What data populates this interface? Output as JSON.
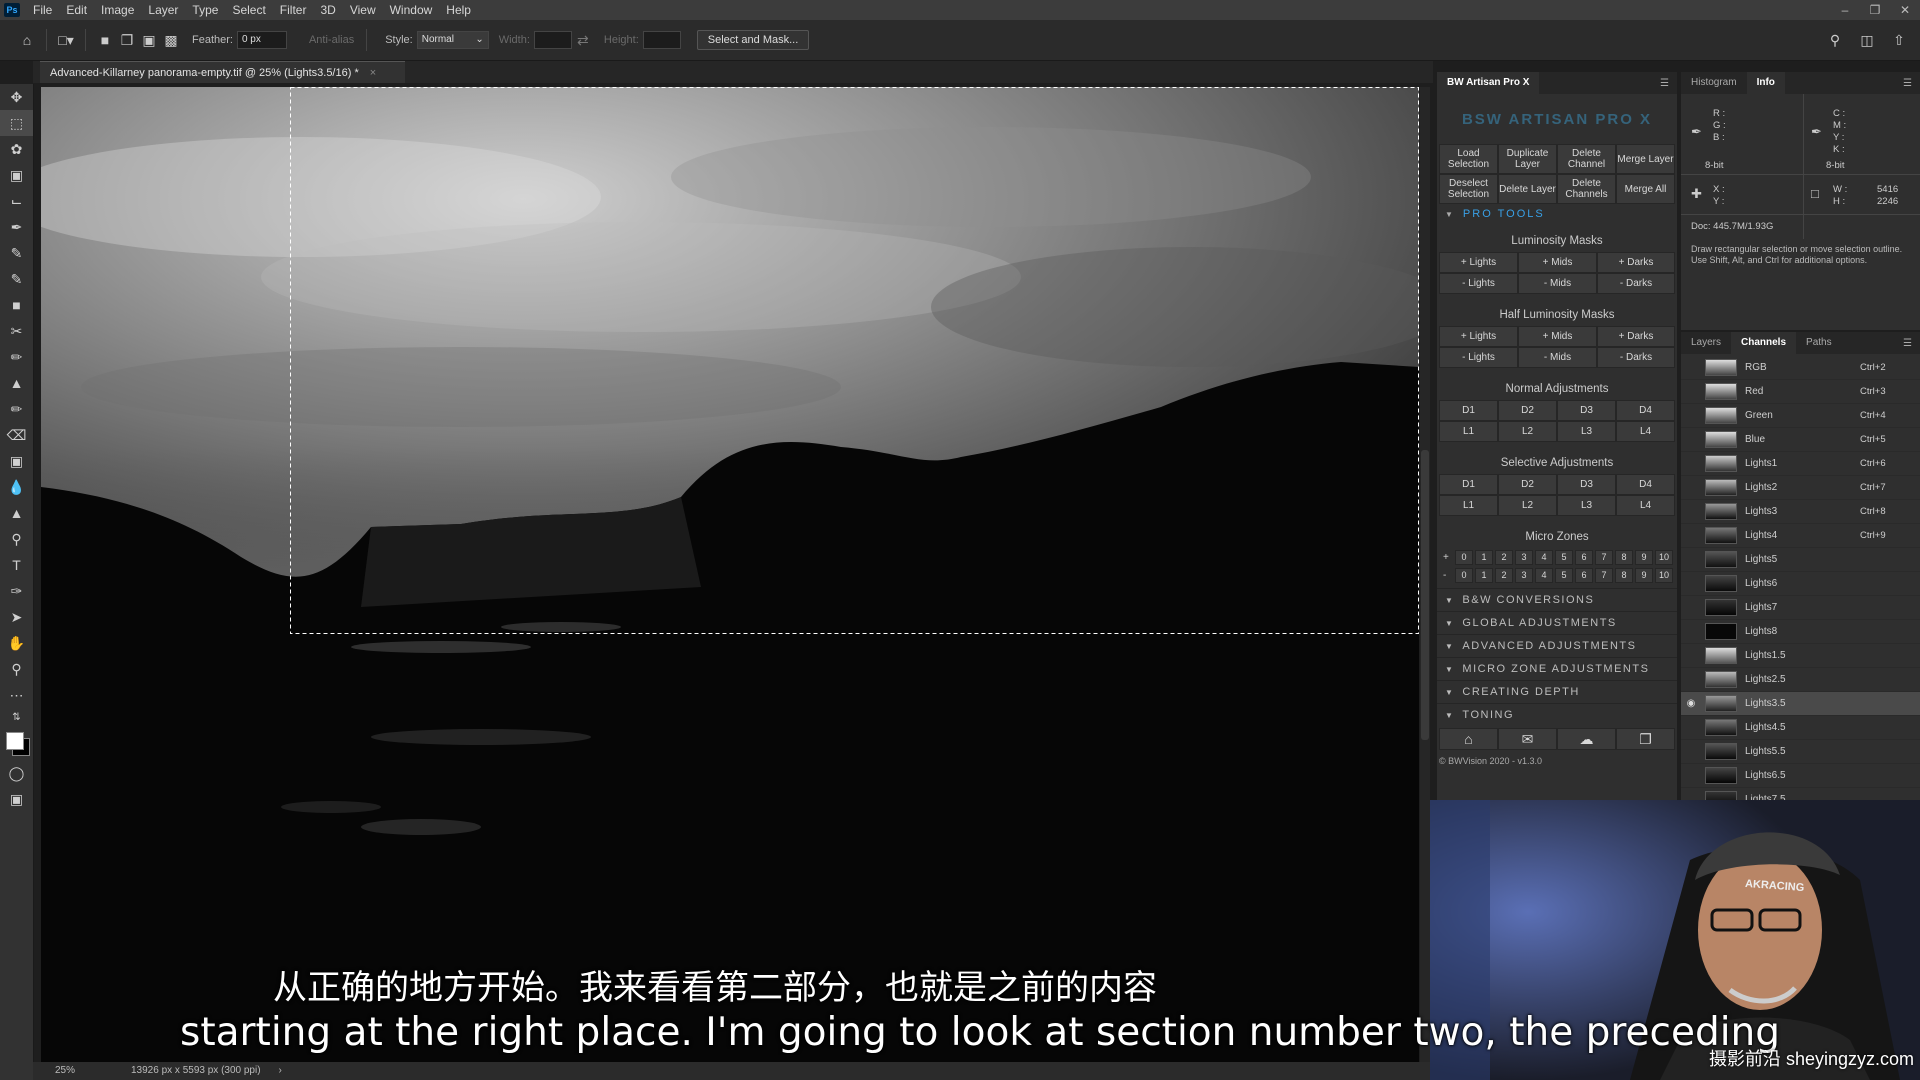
{
  "menubar": {
    "logo": "Ps",
    "items": [
      "File",
      "Edit",
      "Image",
      "Layer",
      "Type",
      "Select",
      "Filter",
      "3D",
      "View",
      "Window",
      "Help"
    ]
  },
  "options": {
    "feather_label": "Feather:",
    "feather_value": "0 px",
    "antialias_label": "Anti-alias",
    "style_label": "Style:",
    "style_value": "Normal",
    "width_label": "Width:",
    "height_label": "Height:",
    "select_mask_button": "Select and Mask..."
  },
  "document": {
    "tab_title": "Advanced-Killarney panorama-empty.tif @ 25% (Lights3.5/16) *",
    "zoom": "25%",
    "dimensions": "13926 px x 5593 px (300 ppi)"
  },
  "bw_panel": {
    "title": "BW Artisan Pro X",
    "logo_text": "BSW ARTISAN PRO X",
    "row1": [
      "Load Selection",
      "Duplicate Layer",
      "Delete Channel",
      "Merge Layer"
    ],
    "row2": [
      "Deselect Selection",
      "Delete Layer",
      "Delete Channels",
      "Merge All"
    ],
    "pro_tools": "PRO TOOLS",
    "luminosity_title": "Luminosity Masks",
    "luminosity_plus": [
      "+ Lights",
      "+ Mids",
      "+ Darks"
    ],
    "luminosity_minus": [
      "- Lights",
      "- Mids",
      "- Darks"
    ],
    "half_title": "Half Luminosity Masks",
    "half_plus": [
      "+ Lights",
      "+ Mids",
      "+ Darks"
    ],
    "half_minus": [
      "- Lights",
      "- Mids",
      "- Darks"
    ],
    "normal_title": "Normal Adjustments",
    "normal_d": [
      "D1",
      "D2",
      "D3",
      "D4"
    ],
    "normal_l": [
      "L1",
      "L2",
      "L3",
      "L4"
    ],
    "selective_title": "Selective Adjustments",
    "selective_d": [
      "D1",
      "D2",
      "D3",
      "D4"
    ],
    "selective_l": [
      "L1",
      "L2",
      "L3",
      "L4"
    ],
    "micro_title": "Micro Zones",
    "micro_plus_sign": "+",
    "micro_minus_sign": "-",
    "micro_numbers": [
      "0",
      "1",
      "2",
      "3",
      "4",
      "5",
      "6",
      "7",
      "8",
      "9",
      "10"
    ],
    "collapsed": [
      "B&W CONVERSIONS",
      "GLOBAL ADJUSTMENTS",
      "ADVANCED ADJUSTMENTS",
      "MICRO ZONE ADJUSTMENTS",
      "CREATING DEPTH",
      "TONING"
    ],
    "footer": "© BWVision 2020 - v1.3.0"
  },
  "info_panel": {
    "tabs": [
      "Histogram",
      "Info"
    ],
    "rgb_labels": [
      "R :",
      "G :",
      "B :"
    ],
    "cmyk_labels": [
      "C :",
      "M :",
      "Y :",
      "K :"
    ],
    "bit_left": "8-bit",
    "bit_right": "8-bit",
    "xy_labels": [
      "X :",
      "Y :"
    ],
    "wh_labels": [
      "W :",
      "H :"
    ],
    "w_value": "5416",
    "h_value": "2246",
    "doc": "Doc: 445.7M/1.93G",
    "hint": "Draw rectangular selection or move selection outline. Use Shift, Alt, and Ctrl for additional options."
  },
  "channels_panel": {
    "tabs": [
      "Layers",
      "Channels",
      "Paths"
    ],
    "rows": [
      {
        "name": "RGB",
        "shortcut": "Ctrl+2"
      },
      {
        "name": "Red",
        "shortcut": "Ctrl+3"
      },
      {
        "name": "Green",
        "shortcut": "Ctrl+4"
      },
      {
        "name": "Blue",
        "shortcut": "Ctrl+5"
      },
      {
        "name": "Lights1",
        "shortcut": "Ctrl+6"
      },
      {
        "name": "Lights2",
        "shortcut": "Ctrl+7"
      },
      {
        "name": "Lights3",
        "shortcut": "Ctrl+8"
      },
      {
        "name": "Lights4",
        "shortcut": "Ctrl+9"
      },
      {
        "name": "Lights5",
        "shortcut": ""
      },
      {
        "name": "Lights6",
        "shortcut": ""
      },
      {
        "name": "Lights7",
        "shortcut": ""
      },
      {
        "name": "Lights8",
        "shortcut": ""
      },
      {
        "name": "Lights1.5",
        "shortcut": ""
      },
      {
        "name": "Lights2.5",
        "shortcut": ""
      },
      {
        "name": "Lights3.5",
        "shortcut": ""
      },
      {
        "name": "Lights4.5",
        "shortcut": ""
      },
      {
        "name": "Lights5.5",
        "shortcut": ""
      },
      {
        "name": "Lights6.5",
        "shortcut": ""
      },
      {
        "name": "Lights7.5",
        "shortcut": ""
      }
    ]
  },
  "webcam": {
    "chair_text": "AKRACING"
  },
  "subtitles": {
    "zh": "从正确的地方开始。我来看看第二部分，也就是之前的内容",
    "en": "starting at the right place. I'm going to look at section number two, the preceding",
    "watermark": "摄影前沿 sheyingzyz.com"
  }
}
